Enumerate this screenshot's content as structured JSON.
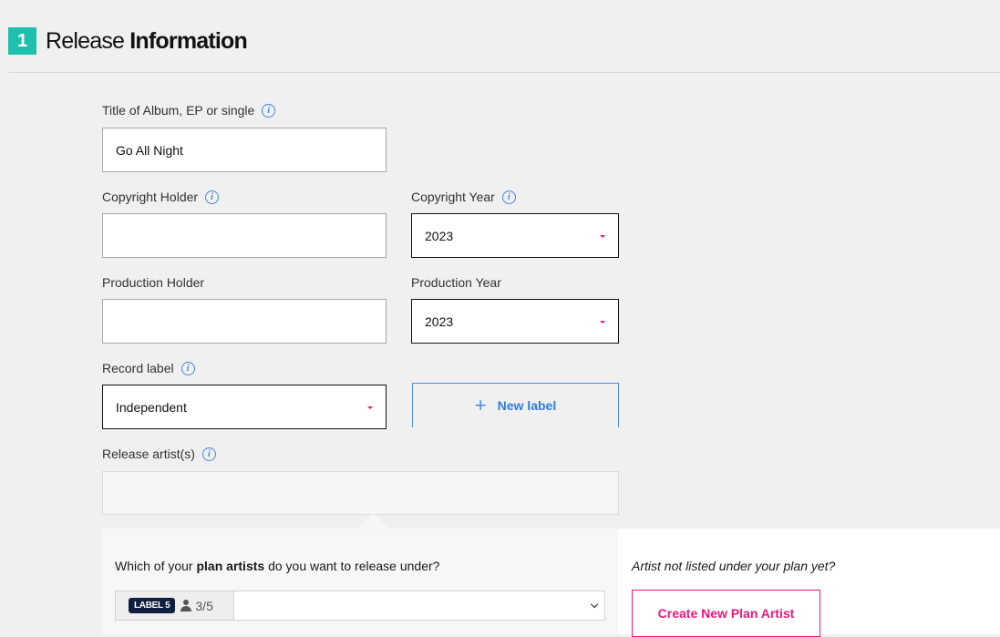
{
  "header": {
    "step_number": "1",
    "title_light": "Release",
    "title_bold": "Information"
  },
  "fields": {
    "title": {
      "label": "Title of Album, EP or single",
      "value": "Go All Night"
    },
    "copyright_holder": {
      "label": "Copyright Holder",
      "value": ""
    },
    "copyright_year": {
      "label": "Copyright Year",
      "value": "2023"
    },
    "production_holder": {
      "label": "Production Holder",
      "value": ""
    },
    "production_year": {
      "label": "Production Year",
      "value": "2023"
    },
    "record_label": {
      "label": "Record label",
      "value": "Independent"
    },
    "release_artists": {
      "label": "Release artist(s)",
      "value": ""
    }
  },
  "buttons": {
    "new_label": "New label",
    "create_plan_artist": "Create New Plan Artist"
  },
  "popover": {
    "question_prefix": "Which of your ",
    "question_bold": "plan artists",
    "question_suffix": " do you want to release under?",
    "plan_badge": "LABEL 5",
    "plan_count": "3/5",
    "selected_artist": "",
    "not_listed": "Artist not listed under your plan yet?"
  },
  "colors": {
    "accent_teal": "#1ec0ad",
    "accent_pink": "#f0177b",
    "link_blue": "#2f7be0",
    "badge_navy": "#0f1f3d"
  }
}
